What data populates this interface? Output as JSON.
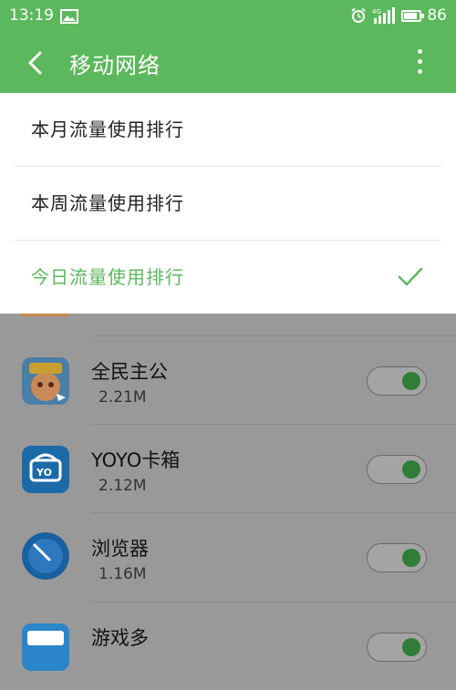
{
  "status_bar": {
    "time": "13:19",
    "battery_level": "86",
    "battery_fraction": 0.86,
    "icons": [
      "image-icon",
      "alarm-icon",
      "signal-icon",
      "battery-icon"
    ]
  },
  "header": {
    "title": "移动网络",
    "back_icon": "back-arrow-icon",
    "more_icon": "more-vertical-icon"
  },
  "menu": {
    "items": [
      {
        "label": "本月流量使用排行",
        "selected": false
      },
      {
        "label": "本周流量使用排行",
        "selected": false
      },
      {
        "label": "今日流量使用排行",
        "selected": true
      }
    ],
    "check_icon": "check-icon"
  },
  "apps": [
    {
      "name": "全民主公",
      "size": "2.21M",
      "icon": "quanmin-zhugong-app-icon",
      "enabled": true
    },
    {
      "name": "YOYO卡箱",
      "size": "2.12M",
      "icon": "yoyo-kaxiang-app-icon",
      "enabled": true
    },
    {
      "name": "浏览器",
      "size": "1.16M",
      "icon": "browser-app-icon",
      "enabled": true
    },
    {
      "name": "游戏多",
      "size": "",
      "icon": "youxiduo-app-icon",
      "enabled": true
    }
  ],
  "colors": {
    "accent": "#5cb85c",
    "overlay": "#999999",
    "toggle_on": "#2f7d36"
  }
}
